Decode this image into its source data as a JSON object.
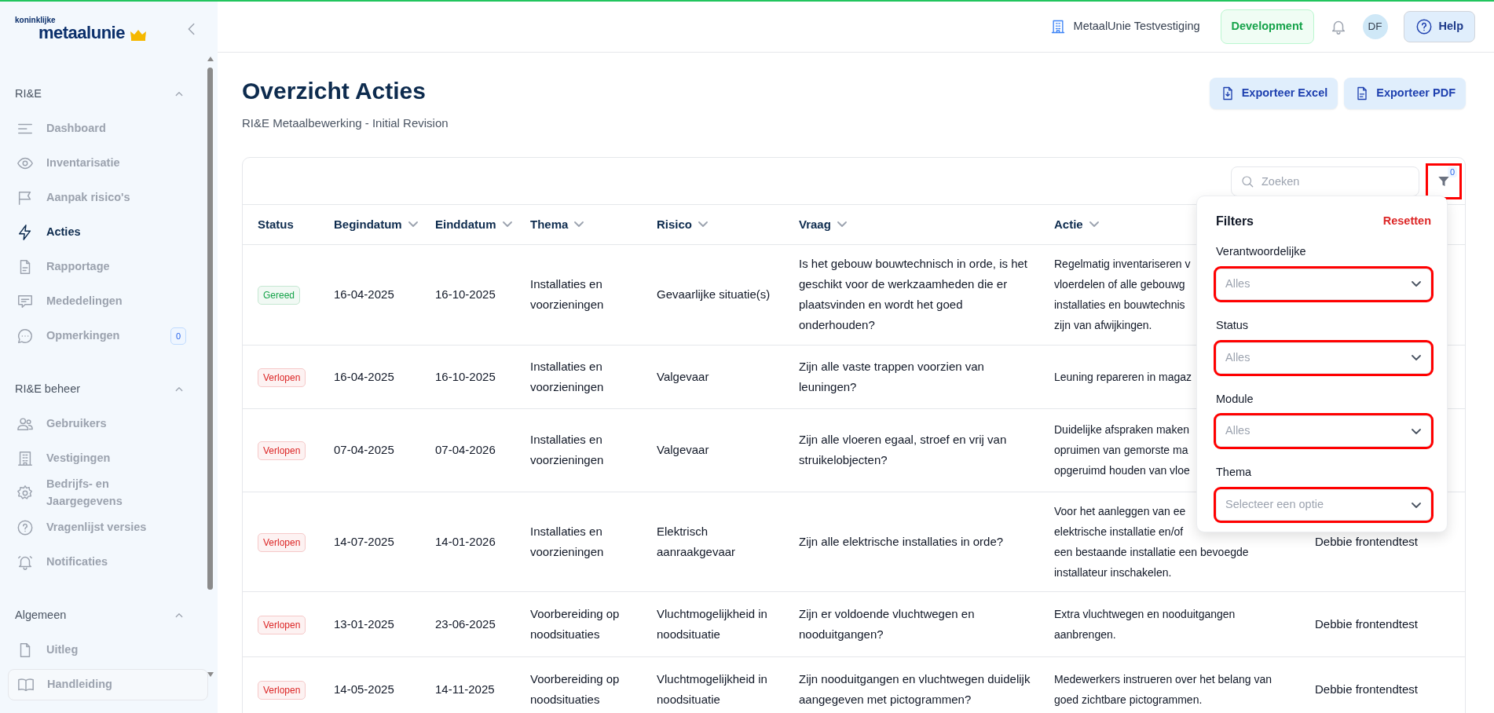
{
  "logo": {
    "small": "koninklijke",
    "main": "metaalunie"
  },
  "sidebar": {
    "sections": [
      {
        "title": "RI&E",
        "expanded": true,
        "items": [
          {
            "label": "Dashboard",
            "selected": false
          },
          {
            "label": "Inventarisatie",
            "selected": false
          },
          {
            "label": "Aanpak risico's",
            "selected": false
          },
          {
            "label": "Acties",
            "selected": true
          },
          {
            "label": "Rapportage",
            "selected": false
          },
          {
            "label": "Mededelingen",
            "selected": false
          },
          {
            "label": "Opmerkingen",
            "selected": false,
            "badge": "0"
          }
        ]
      },
      {
        "title": "RI&E beheer",
        "expanded": true,
        "items": [
          {
            "label": "Gebruikers",
            "selected": false
          },
          {
            "label": "Vestigingen",
            "selected": false
          },
          {
            "label": "Bedrijfs- en Jaargegevens",
            "selected": false
          },
          {
            "label": "Vragenlijst versies",
            "selected": false
          },
          {
            "label": "Notificaties",
            "selected": false
          }
        ]
      },
      {
        "title": "Algemeen",
        "expanded": true,
        "items": [
          {
            "label": "Uitleg",
            "selected": false
          },
          {
            "label": "Handleiding",
            "selected": false
          }
        ]
      }
    ]
  },
  "topbar": {
    "location": "MetaalUnie Testvestiging",
    "environment": "Development",
    "avatar": "DF",
    "help": "Help"
  },
  "page": {
    "title": "Overzicht Acties",
    "subtitle": "RI&E Metaalbewerking - Initial Revision",
    "buttons": [
      "Exporteer Excel",
      "Exporteer PDF"
    ]
  },
  "toolbar": {
    "search_placeholder": "Zoeken",
    "filter_count": "0",
    "filter_highlighted": true
  },
  "filters": {
    "title": "Filters",
    "reset": "Resetten",
    "fields": [
      {
        "label": "Verantwoordelijke",
        "placeholder": "Alles",
        "highlighted": true
      },
      {
        "label": "Status",
        "placeholder": "Alles",
        "highlighted": true
      },
      {
        "label": "Module",
        "placeholder": "Alles",
        "highlighted": true
      },
      {
        "label": "Thema",
        "placeholder": "Selecteer een optie",
        "highlighted": true
      }
    ]
  },
  "table": {
    "columns": [
      {
        "label": "Status",
        "sortable": false
      },
      {
        "label": "Begindatum",
        "sortable": true
      },
      {
        "label": "Einddatum",
        "sortable": true
      },
      {
        "label": "Thema",
        "sortable": true
      },
      {
        "label": "Risico",
        "sortable": true
      },
      {
        "label": "Vraag",
        "sortable": true
      },
      {
        "label": "Actie",
        "sortable": true
      }
    ],
    "rows": [
      {
        "status": {
          "label": "Gereed",
          "color": "#16a34a"
        },
        "begindatum": "16-04-2025",
        "einddatum": "16-10-2025",
        "thema": "Installaties en voorzieningen",
        "risico": "Gevaarlijke situatie(s)",
        "vraag": "Is het gebouw bouwtechnisch in orde, is het geschikt voor de werkzaamheden die er plaatsvinden en wordt het goed onderhouden?",
        "actie": [
          "Regelmatig inventariseren v",
          "vloerdelen of alle gebouwg",
          "installaties en bouwtechnis",
          "zijn van afwijkingen."
        ]
      },
      {
        "status": {
          "label": "Verlopen",
          "color": "#dc2626"
        },
        "begindatum": "16-04-2025",
        "einddatum": "16-10-2025",
        "thema": "Installaties en voorzieningen",
        "risico": "Valgevaar",
        "vraag": "Zijn alle vaste trappen voorzien van leuningen?",
        "actie": [
          "Leuning repareren in magaz"
        ]
      },
      {
        "status": {
          "label": "Verlopen",
          "color": "#dc2626"
        },
        "begindatum": "07-04-2025",
        "einddatum": "07-04-2026",
        "thema": "Installaties en voorzieningen",
        "risico": "Valgevaar",
        "vraag": "Zijn alle vloeren egaal, stroef en vrij van struikelobjecten?",
        "actie": [
          "Duidelijke afspraken maken",
          "opruimen van gemorste ma",
          "opgeruimd houden van vloe"
        ]
      },
      {
        "status": {
          "label": "Verlopen",
          "color": "#dc2626"
        },
        "begindatum": "14-07-2025",
        "einddatum": "14-01-2026",
        "thema": "Installaties en voorzieningen",
        "risico": "Elektrisch aanraakgevaar",
        "vraag": "Zijn alle elektrische installaties in orde?",
        "actie": [
          "Voor het aanleggen van ee",
          "elektrische installatie en/of",
          "een bestaande installatie een bevoegde",
          "installateur inschakelen."
        ],
        "verantwoordelijke": "Debbie frontendtest"
      },
      {
        "status": {
          "label": "Verlopen",
          "color": "#dc2626"
        },
        "begindatum": "13-01-2025",
        "einddatum": "23-06-2025",
        "thema": "Voorbereiding op noodsituaties",
        "risico": "Vluchtmogelijkheid in noodsituatie",
        "vraag": "Zijn er voldoende vluchtwegen en nooduitgangen?",
        "actie": [
          "Extra vluchtwegen en nooduitgangen",
          "aanbrengen."
        ],
        "verantwoordelijke": "Debbie frontendtest"
      },
      {
        "status": {
          "label": "Verlopen",
          "color": "#dc2626"
        },
        "begindatum": "14-05-2025",
        "einddatum": "14-11-2025",
        "thema": "Voorbereiding op noodsituaties",
        "risico": "Vluchtmogelijkheid in noodsituatie",
        "vraag": "Zijn nooduitgangen en vluchtwegen duidelijk aangegeven met pictogrammen?",
        "actie": [
          "Medewerkers instrueren over het belang van",
          "goed zichtbare pictogrammen."
        ],
        "verantwoordelijke": "Debbie frontendtest"
      }
    ]
  }
}
